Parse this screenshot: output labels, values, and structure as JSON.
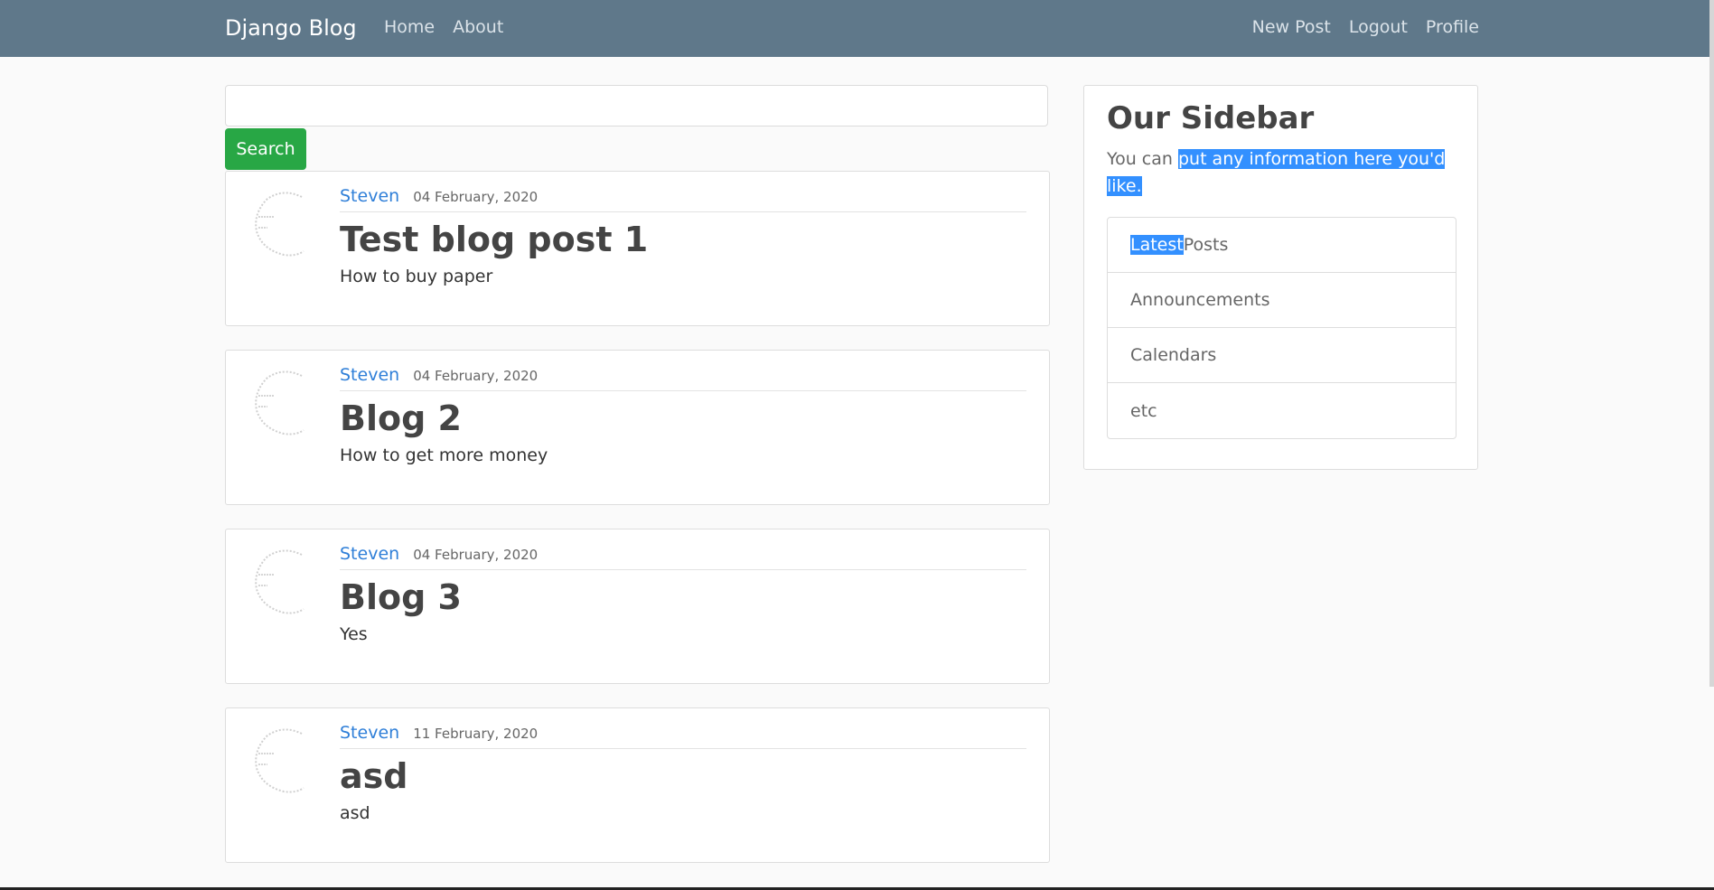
{
  "navbar": {
    "brand": "Django Blog",
    "left_links": [
      "Home",
      "About"
    ],
    "right_links": [
      "New Post",
      "Logout",
      "Profile"
    ],
    "background": "#5f788a"
  },
  "search": {
    "placeholder": "",
    "button_label": "Search",
    "button_color": "#28a745"
  },
  "posts": [
    {
      "author": "Steven",
      "date": "04 February, 2020",
      "title": "Test blog post 1",
      "content": "How to buy paper"
    },
    {
      "author": "Steven",
      "date": "04 February, 2020",
      "title": "Blog 2",
      "content": "How to get more money"
    },
    {
      "author": "Steven",
      "date": "04 February, 2020",
      "title": "Blog 3",
      "content": "Yes"
    },
    {
      "author": "Steven",
      "date": "11 February, 2020",
      "title": "asd",
      "content": "asd"
    }
  ],
  "sidebar": {
    "title": "Our Sidebar",
    "text_plain": "You can ",
    "text_highlighted": "put any information here you'd like.",
    "items": [
      {
        "highlighted": "Latest",
        "rest": " Posts"
      },
      {
        "highlighted": "",
        "rest": "Announcements"
      },
      {
        "highlighted": "",
        "rest": "Calendars"
      },
      {
        "highlighted": "",
        "rest": "etc"
      }
    ]
  },
  "colors": {
    "link": "#2f7fd8",
    "selection": "#3390ff"
  }
}
